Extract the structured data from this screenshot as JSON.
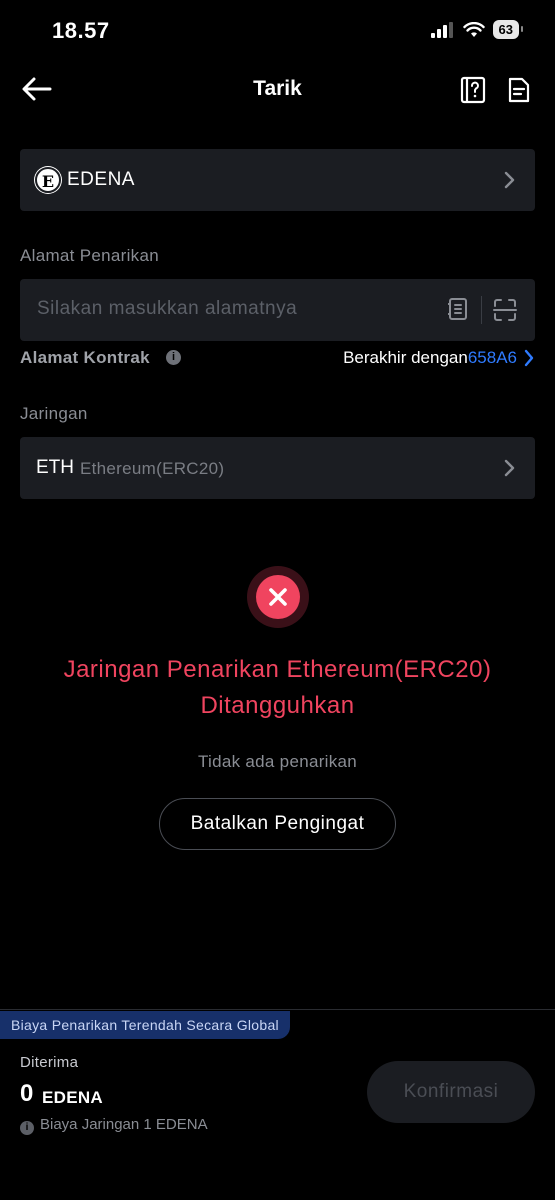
{
  "status": {
    "time": "18.57",
    "battery": "63"
  },
  "nav": {
    "title": "Tarik"
  },
  "coin": {
    "logo_letter": "E",
    "name": "EDENA"
  },
  "address": {
    "label": "Alamat Penarikan",
    "placeholder": "Silakan masukkan alamatnya"
  },
  "contract": {
    "label": "Alamat Kontrak",
    "prefix": "Berakhir dengan",
    "hash": "658A6"
  },
  "network": {
    "label": "Jaringan",
    "main": "ETH",
    "sub": "Ethereum(ERC20)"
  },
  "error": {
    "title": "Jaringan Penarikan Ethereum(ERC20) Ditangguhkan",
    "subtitle": "Tidak ada penarikan",
    "button": "Batalkan Pengingat"
  },
  "footer": {
    "promo": "Biaya Penarikan Terendah Secara Global",
    "received_label": "Diterima",
    "amount": "0",
    "unit": "EDENA",
    "fee": "Biaya Jaringan 1 EDENA",
    "confirm": "Konfirmasi"
  },
  "colors": {
    "error": "#f0445f",
    "link": "#2f7bff",
    "card": "#1b1d22",
    "promo": "#17306a"
  }
}
